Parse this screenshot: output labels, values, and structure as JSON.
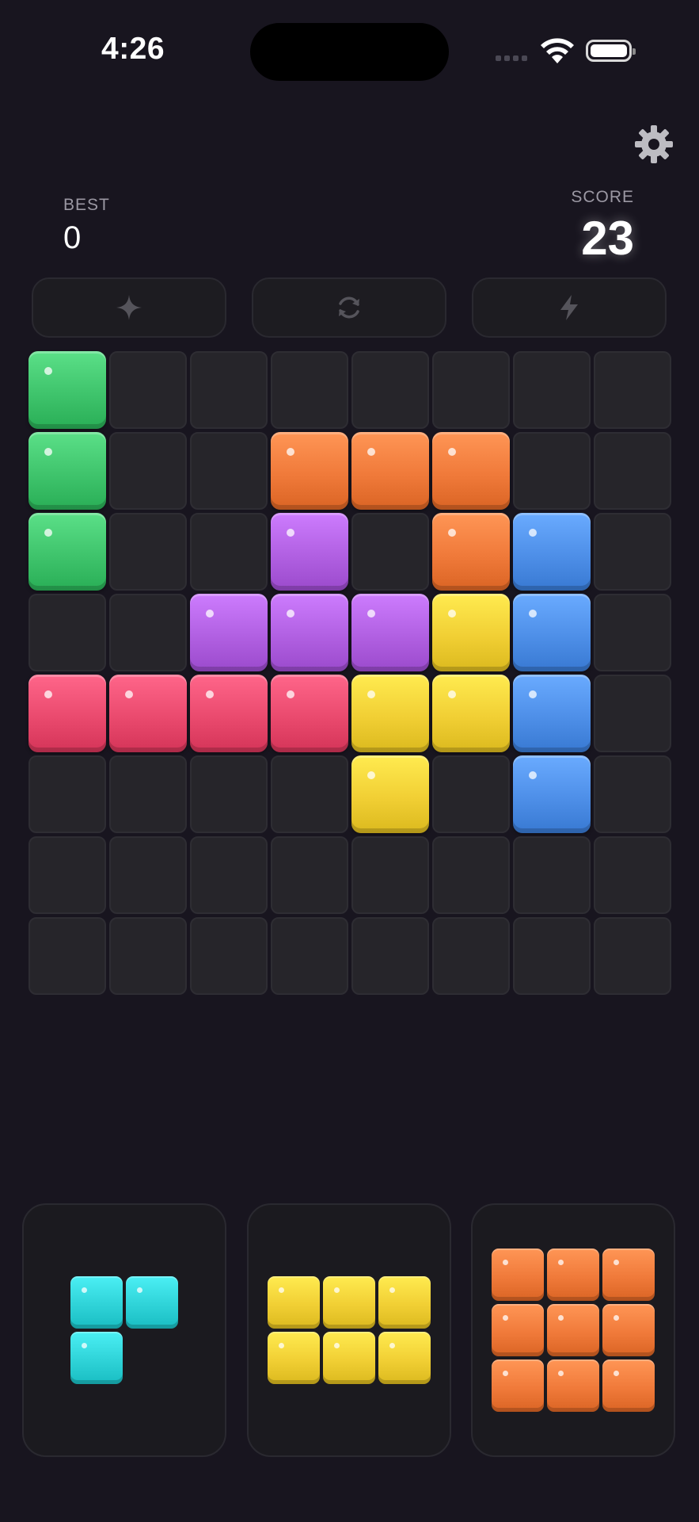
{
  "status_bar": {
    "time": "4:26"
  },
  "header": {
    "best_label": "BEST",
    "best_value": "0",
    "score_label": "SCORE",
    "score_value": "23"
  },
  "powerups": [
    {
      "name": "sparkle-icon"
    },
    {
      "name": "refresh-icon"
    },
    {
      "name": "lightning-icon"
    }
  ],
  "colors": {
    "green": "#3fc46c",
    "orange": "#f07a3a",
    "purple": "#b160e2",
    "blue": "#4e8fe8",
    "yellow": "#f1cf34",
    "pink": "#ea4a6e",
    "cyan": "#2fd3d8",
    "empty": "#26252a",
    "background": "#18151f"
  },
  "board": {
    "rows": 8,
    "cols": 8,
    "grid": [
      [
        "green",
        "",
        "",
        "",
        "",
        "",
        "",
        ""
      ],
      [
        "green",
        "",
        "",
        "orange",
        "orange",
        "orange",
        "",
        ""
      ],
      [
        "green",
        "",
        "",
        "purple",
        "",
        "orange",
        "blue",
        ""
      ],
      [
        "",
        "",
        "purple",
        "purple",
        "purple",
        "yellow",
        "blue",
        ""
      ],
      [
        "pink",
        "pink",
        "pink",
        "pink",
        "yellow",
        "yellow",
        "blue",
        ""
      ],
      [
        "",
        "",
        "",
        "",
        "yellow",
        "",
        "blue",
        ""
      ],
      [
        "",
        "",
        "",
        "",
        "",
        "",
        "",
        ""
      ],
      [
        "",
        "",
        "",
        "",
        "",
        "",
        "",
        ""
      ]
    ]
  },
  "pieces": [
    {
      "color": "cyan",
      "shape": [
        [
          1,
          1
        ],
        [
          1,
          0
        ]
      ]
    },
    {
      "color": "yellow",
      "shape": [
        [
          1,
          1,
          1
        ],
        [
          1,
          1,
          1
        ]
      ]
    },
    {
      "color": "orange",
      "shape": [
        [
          1,
          1,
          1
        ],
        [
          1,
          1,
          1
        ],
        [
          1,
          1,
          1
        ]
      ]
    }
  ]
}
